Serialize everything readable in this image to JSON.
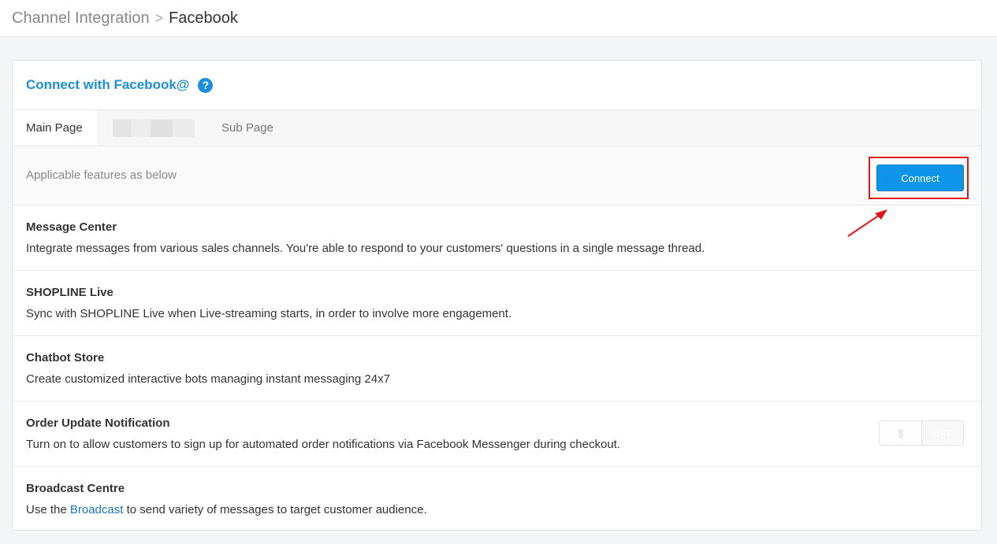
{
  "breadcrumb": {
    "parent": "Channel Integration",
    "separator": ">",
    "current": "Facebook"
  },
  "card": {
    "title": "Connect with Facebook@",
    "help_icon": "question-circle-icon"
  },
  "tabs": [
    {
      "label": "Main Page",
      "active": true
    },
    {
      "label": "Sub Page",
      "active": false
    }
  ],
  "features_intro": "Applicable features as below",
  "connect_label": "Connect",
  "features": [
    {
      "name": "Message Center",
      "desc": "Integrate messages from various sales channels. You're able to respond to your customers' questions in a single message thread."
    },
    {
      "name": "SHOPLINE Live",
      "desc": "Sync with SHOPLINE Live when Live-streaming starts, in order to involve more engagement."
    },
    {
      "name": "Chatbot Store",
      "desc": "Create customized interactive bots managing instant messaging 24x7"
    },
    {
      "name": "Order Update Notification",
      "desc": "Turn on to allow customers to sign up for automated order notifications via Facebook Messenger during checkout.",
      "toggle_handle": "|||",
      "toggle_label": "OFF"
    },
    {
      "name": "Broadcast Centre",
      "desc_before": "Use the",
      "desc_link": "Broadcast",
      "desc_after": "to send variety of messages to target customer audience."
    }
  ],
  "colors": {
    "accent": "#1a8fdc",
    "button": "#0e94e8",
    "highlight": "#e3161c"
  }
}
